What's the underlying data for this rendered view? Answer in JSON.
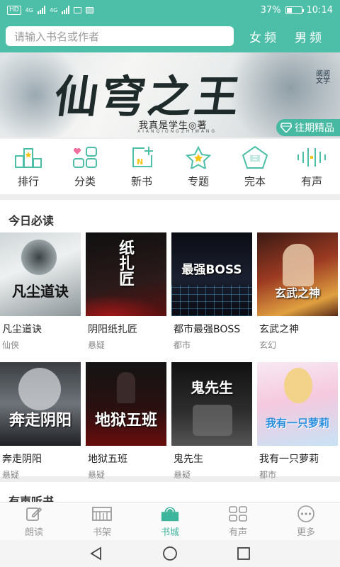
{
  "status_bar": {
    "hd": "HD",
    "net1": "4G",
    "net2": "4G",
    "battery": "37%",
    "time": "10:14"
  },
  "header": {
    "search_placeholder": "请输入书名或作者",
    "tab_female": "女频",
    "tab_male": "男频"
  },
  "banner": {
    "title": "仙穹之王",
    "author": "我真是学生◎著",
    "pinyin": "XIANQIONGZHIWANG",
    "logo_text": "阅阅文学",
    "badge": "往期精品"
  },
  "categories": [
    {
      "label": "排行",
      "icon": "ranking-icon"
    },
    {
      "label": "分类",
      "icon": "category-icon"
    },
    {
      "label": "新书",
      "icon": "new-book-icon"
    },
    {
      "label": "专题",
      "icon": "topic-star-icon"
    },
    {
      "label": "完本",
      "icon": "completed-icon"
    },
    {
      "label": "有声",
      "icon": "audio-wave-icon"
    }
  ],
  "today": {
    "title": "今日必读",
    "books": [
      {
        "name": "凡尘道诀",
        "genre": "仙侠",
        "cover_text": "凡尘道诀"
      },
      {
        "name": "阴阳纸扎匠",
        "genre": "悬疑",
        "cover_text": "纸扎匠"
      },
      {
        "name": "都市最强BOSS",
        "genre": "都市",
        "cover_text": "最强BOSS"
      },
      {
        "name": "玄武之神",
        "genre": "玄幻",
        "cover_text": "玄武之神"
      },
      {
        "name": "奔走阴阳",
        "genre": "悬疑",
        "cover_text": "奔走阴阳"
      },
      {
        "name": "地狱五班",
        "genre": "悬疑",
        "cover_text": "地狱五班"
      },
      {
        "name": "鬼先生",
        "genre": "悬疑",
        "cover_text": "鬼先生"
      },
      {
        "name": "我有一只萝莉",
        "genre": "都市",
        "cover_text": "我有一只萝莉"
      }
    ]
  },
  "audio_section": {
    "title": "有声听书"
  },
  "bottom_nav": [
    {
      "label": "朗读",
      "icon": "edit-read-icon"
    },
    {
      "label": "书架",
      "icon": "bookshelf-icon"
    },
    {
      "label": "书城",
      "icon": "bookstore-icon",
      "active": true
    },
    {
      "label": "有声",
      "icon": "grid-audio-icon"
    },
    {
      "label": "更多",
      "icon": "more-dots-icon"
    }
  ],
  "colors": {
    "accent": "#4dbfa8",
    "active_tab": "#3fb49c"
  }
}
